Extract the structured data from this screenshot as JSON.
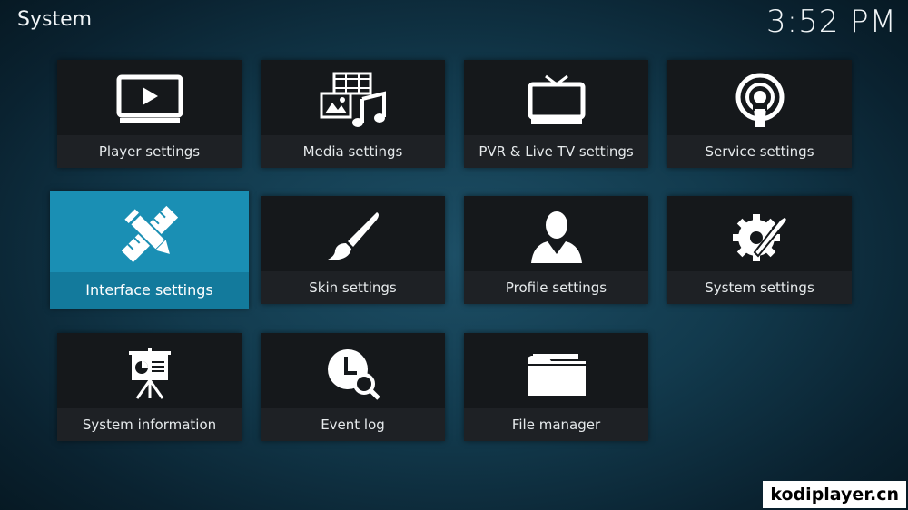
{
  "header": {
    "title": "System",
    "clock": "3:52 PM"
  },
  "tiles": [
    {
      "label": "Player settings",
      "icon": "monitor-play-icon"
    },
    {
      "label": "Media settings",
      "icon": "media-icon"
    },
    {
      "label": "PVR & Live TV settings",
      "icon": "tv-icon"
    },
    {
      "label": "Service settings",
      "icon": "podcast-icon"
    },
    {
      "label": "Interface settings",
      "icon": "pencil-ruler-icon",
      "focused": true
    },
    {
      "label": "Skin settings",
      "icon": "paintbrush-icon"
    },
    {
      "label": "Profile settings",
      "icon": "user-icon"
    },
    {
      "label": "System settings",
      "icon": "gear-wrench-icon"
    },
    {
      "label": "System information",
      "icon": "presentation-board-icon"
    },
    {
      "label": "Event log",
      "icon": "clock-search-icon"
    },
    {
      "label": "File manager",
      "icon": "folder-icon"
    }
  ],
  "watermark": "kodiplayer.cn",
  "colors": {
    "focus": "#1a8fb4",
    "tile": "#15181b"
  }
}
